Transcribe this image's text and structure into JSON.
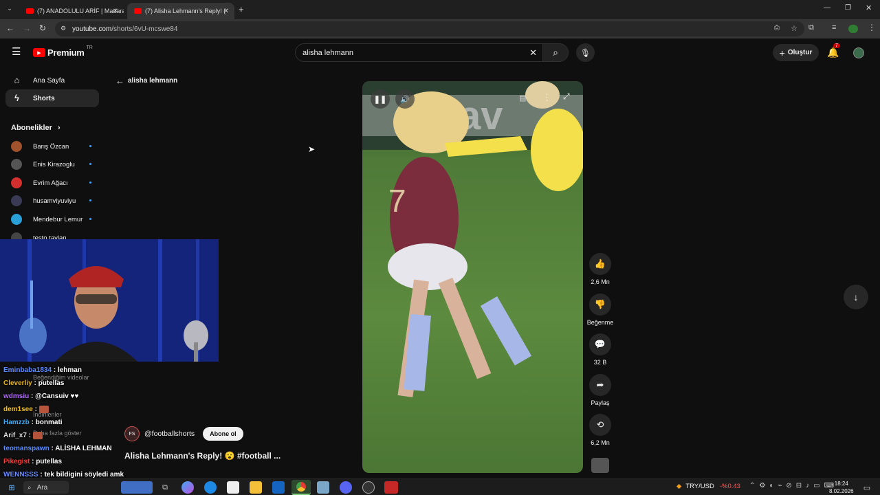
{
  "browser": {
    "tabs": [
      {
        "title": "(7) ANADOLULU ARİF | Madara",
        "active": false
      },
      {
        "title": "(7) Alisha Lehmann's Reply! (",
        "active": true
      }
    ],
    "url_domain": "youtube.com",
    "url_path": "/shorts/6vU-mcswe84"
  },
  "header": {
    "logo": "Premium",
    "logo_sup": "TR",
    "search_value": "alisha lehmann",
    "create_label": "Oluştur",
    "notif_count": "7"
  },
  "sidebar": {
    "items": [
      {
        "label": "Ana Sayfa",
        "icon": "home-icon"
      },
      {
        "label": "Shorts",
        "icon": "shorts-icon"
      }
    ],
    "subs_title": "Abonelikler",
    "subs": [
      {
        "label": "Barış Özcan",
        "color": "#a0522d"
      },
      {
        "label": "Enis Kirazoglu",
        "color": "#555555"
      },
      {
        "label": "Evrim Ağacı",
        "color": "#d32f2f"
      },
      {
        "label": "husamviyuviyu",
        "color": "#3a3a55"
      },
      {
        "label": "Mendebur Lemur",
        "color": "#2aa0d8"
      },
      {
        "label": "testo taylan",
        "color": "#444444"
      }
    ],
    "faded": [
      "Beğendiğim videolar",
      "İndirilenler",
      "Daha fazla göster"
    ]
  },
  "back": {
    "label": "alisha lehmann"
  },
  "video": {
    "channel": "@footballshorts",
    "channel_initials": "FS",
    "subscribe_label": "Abone ol",
    "title": "Alisha Lehmann's Reply! 😮 #football ...",
    "actions": [
      {
        "icon": "thumbs-up-icon",
        "label": "2,6 Mn"
      },
      {
        "icon": "thumbs-down-icon",
        "label": "Beğenme"
      },
      {
        "icon": "comment-icon",
        "label": "32 B"
      },
      {
        "icon": "share-icon",
        "label": "Paylaş"
      },
      {
        "icon": "remix-icon",
        "label": "6,2 Mn"
      }
    ]
  },
  "chat": [
    {
      "user": "Eminbaba1834",
      "msg": "lehman",
      "color": "#5b8cff"
    },
    {
      "user": "Cleverliy",
      "msg": "putellas",
      "color": "#e6b422"
    },
    {
      "user": "wdmsiu",
      "msg": "@Cansuiv ♥♥",
      "color": "#b36bff"
    },
    {
      "user": "dem1see",
      "msg": "",
      "color": "#f0c020"
    },
    {
      "user": "Hamzzb",
      "msg": "bonmati",
      "color": "#3fa9f5"
    },
    {
      "user": "Arif_x7",
      "msg": "",
      "color": "#dddddd"
    },
    {
      "user": "teomanspawn",
      "msg": "ALİSHA LEHMAN",
      "color": "#5b8cff"
    },
    {
      "user": "Pikegist",
      "msg": "putellas",
      "color": "#ff3b3b"
    },
    {
      "user": "WENNSSS",
      "msg": "tek bildigini söyledi amk",
      "color": "#6a8cff"
    }
  ],
  "taskbar": {
    "search_label": "Ara",
    "currency": "TRY/USD",
    "currency_change": "-%0.43",
    "time": "18:24",
    "date": "8.02.2026"
  }
}
